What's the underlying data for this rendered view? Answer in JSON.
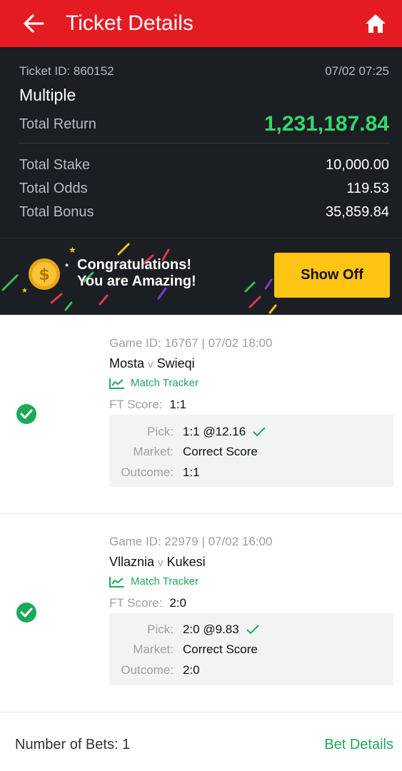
{
  "header": {
    "title": "Ticket Details",
    "back_icon": "arrow-left-icon",
    "home_icon": "home-icon",
    "background": "#e41b23"
  },
  "summary": {
    "ticket_id": "Ticket ID: 860152",
    "timestamp": "07/02 07:25",
    "bet_type": "Multiple",
    "total_return_label": "Total Return",
    "total_return_value": "1,231,187.84",
    "rows": [
      {
        "label": "Total Stake",
        "value": "10,000.00"
      },
      {
        "label": "Total Odds",
        "value": "119.53"
      },
      {
        "label": "Total Bonus",
        "value": "35,859.84"
      }
    ],
    "accent": "#33d96b"
  },
  "banner": {
    "line1": "Congratulations!",
    "line2": "You are Amazing!",
    "button_label": "Show Off",
    "button_color": "#ffc414",
    "coin_icon": "coin-icon"
  },
  "bets": [
    {
      "game_id": "Game ID: 16767 | 07/02 18:00",
      "home": "Mosta",
      "vs": "v",
      "away": "Swieqi",
      "tracker_label": "Match Tracker",
      "ft_label": "FT Score:",
      "ft_value": "1:1",
      "pick_label": "Pick:",
      "pick_value": "1:1 @12.16",
      "market_label": "Market:",
      "market_value": "Correct Score",
      "outcome_label": "Outcome:",
      "outcome_value": "1:1",
      "status": "won"
    },
    {
      "game_id": "Game ID: 22979 | 07/02  16:00",
      "home": "Vllaznia",
      "vs": "v",
      "away": "Kukesi",
      "tracker_label": "Match Tracker",
      "ft_label": "FT Score:",
      "ft_value": "2:0",
      "pick_label": "Pick:",
      "pick_value": "2:0 @9.83",
      "market_label": "Market:",
      "market_value": "Correct Score",
      "outcome_label": "Outcome:",
      "outcome_value": "2:0",
      "status": "won"
    }
  ],
  "footer": {
    "count_label": "Number of Bets: 1",
    "details_link": "Bet Details",
    "link_color": "#1ea85a"
  }
}
